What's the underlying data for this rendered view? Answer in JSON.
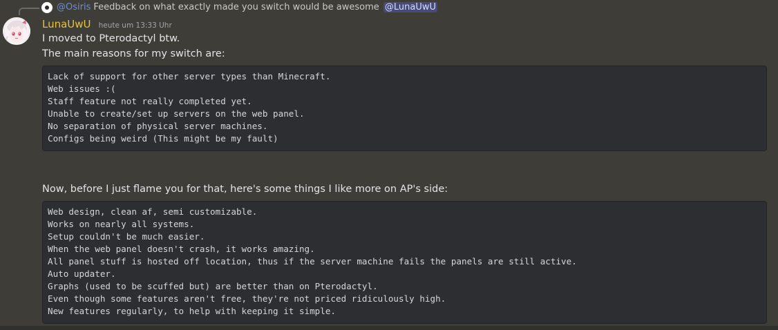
{
  "reply": {
    "mention_prefix": "@",
    "mentioned_user": "Osiris",
    "text": "Feedback on what exactly made you switch would be awesome",
    "mention_tag": "@LunaUwU"
  },
  "message": {
    "author": "LunaUwU",
    "timestamp": "heute um 13:33 Uhr",
    "lines": [
      "I moved to Pterodactyl btw.",
      "The main reasons for my switch are:"
    ],
    "code_block_1": [
      "Lack of support for other server types than Minecraft.",
      "Web issues :(",
      "Staff feature not really completed yet.",
      "Unable to create/set up servers on the web panel.",
      "No separation of physical server machines.",
      "Configs being weird (This might be my fault)"
    ],
    "middle_line": "Now, before I just flame you for that, here's some things I like more on AP's side:",
    "code_block_2": [
      "Web design, clean af, semi customizable.",
      "Works on nearly all systems.",
      "Setup couldn't be much easier.",
      "When the web panel doesn't crash, it works amazing.",
      "All panel stuff is hosted off location, thus if the server machine fails the panels are still active.",
      "Auto updater.",
      "Graphs (used to be scuffed but) are better than on Pterodactyl.",
      "Even though some features aren't free, they're not priced ridiculously high.",
      "New features regularly, to help with keeping it simple."
    ]
  },
  "colors": {
    "background": "#3f3d38",
    "author": "#e9c13a",
    "mention": "#6a8fd1",
    "codeblock_bg": "#2d2e31"
  }
}
